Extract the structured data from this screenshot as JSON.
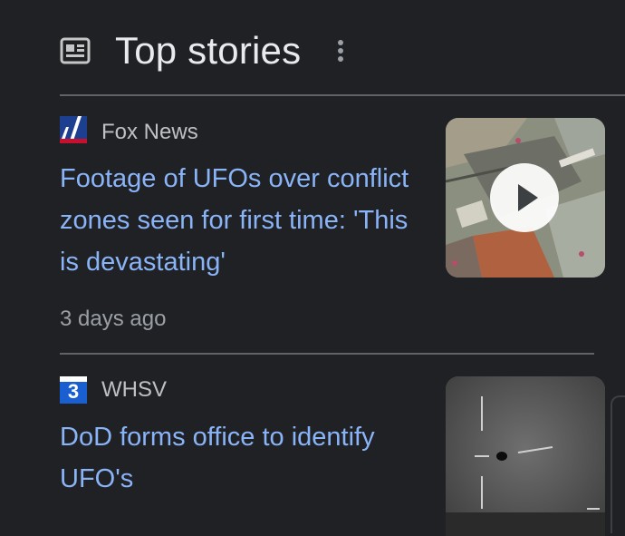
{
  "section": {
    "title": "Top stories",
    "icon": "newspaper-icon",
    "menu_icon": "more-vert-icon"
  },
  "stories": [
    {
      "source": "Fox News",
      "source_logo": "fox-news-logo",
      "headline": "Footage of UFOs over conflict zones seen for first time: 'This is devastating'",
      "age": "3 days ago",
      "thumbnail": "aerial-footage-thumbnail",
      "has_video": true
    },
    {
      "source": "WHSV",
      "source_logo": "whsv-3-logo",
      "logo_text": "3",
      "headline": "DoD forms office to identify UFO's",
      "thumbnail": "night-sky-ufo-thumbnail",
      "has_video": false
    }
  ],
  "colors": {
    "background": "#202124",
    "headline": "#8ab4f8",
    "title": "#e8eaed",
    "source": "#bdc1c6",
    "meta": "#9aa0a6",
    "divider": "#5f6368"
  }
}
